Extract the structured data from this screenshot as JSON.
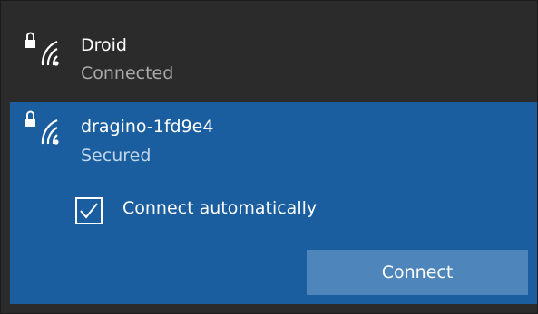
{
  "networks": [
    {
      "name": "Droid",
      "status": "Connected",
      "icon": "secured-wifi-icon"
    },
    {
      "name": "dragino-1fd9e4",
      "status": "Secured",
      "icon": "secured-wifi-icon"
    }
  ],
  "auto_connect": {
    "label": "Connect automatically",
    "checked": true
  },
  "connect_button": {
    "label": "Connect"
  },
  "colors": {
    "panel_dark": "#2b2b2b",
    "selected_blue": "#1b5ea0",
    "button_blue": "#4e86bb",
    "text_white": "#ffffff",
    "status_gray": "#a9a9a9"
  }
}
